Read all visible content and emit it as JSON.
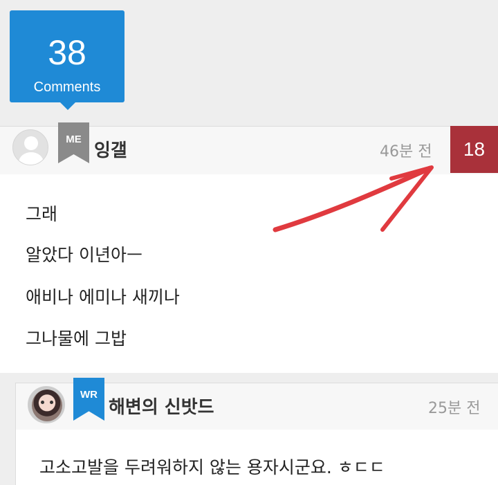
{
  "comments_header": {
    "count": "38",
    "label": "Comments"
  },
  "comments": [
    {
      "author": "잉갤",
      "badge": "ME",
      "time": "46분 전",
      "votes": "18",
      "lines": [
        "그래",
        "알았다 이년아ㅡ",
        "애비나 에미나 새끼나",
        "그나물에 그밥"
      ]
    },
    {
      "author": "해변의 신밧드",
      "badge": "WR",
      "time": "25분 전",
      "lines": [
        "고소고발을 두려워하지 않는 용자시군요. ㅎㄷㄷ"
      ]
    }
  ],
  "colors": {
    "accent_blue": "#1f8ad6",
    "vote_badge": "#a9313a",
    "me_ribbon": "#8a8a8a",
    "arrow": "#e03a3f"
  }
}
